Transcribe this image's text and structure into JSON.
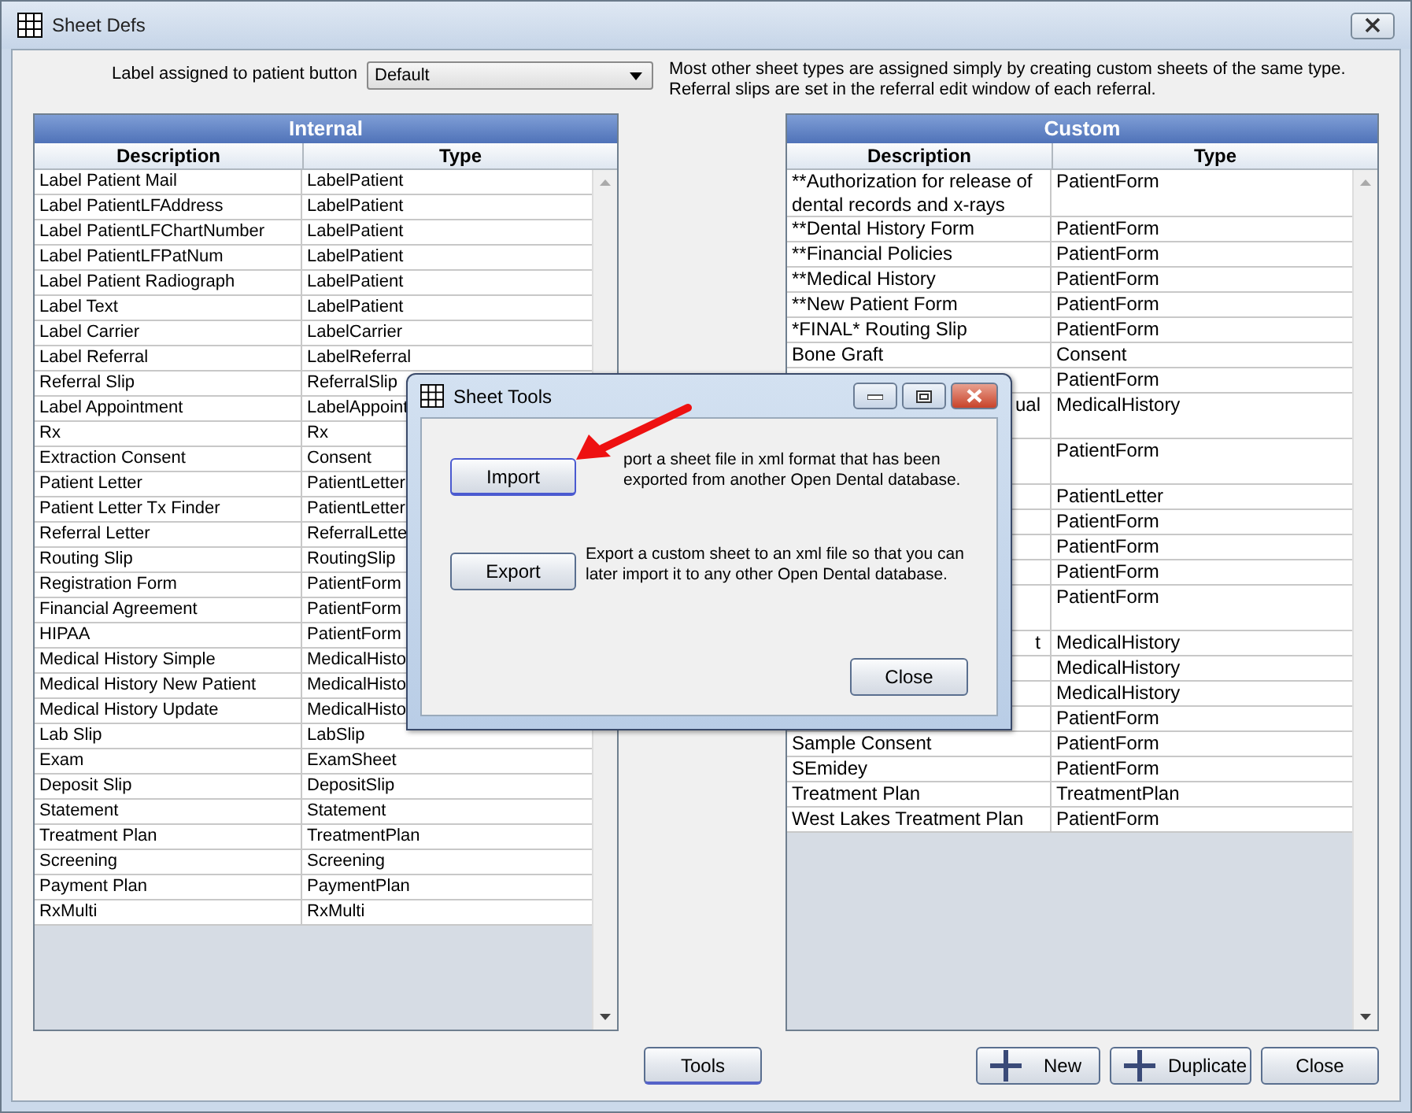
{
  "window": {
    "title": "Sheet Defs"
  },
  "patient_button": {
    "label": "Label assigned to patient button",
    "value": "Default"
  },
  "note_lines": [
    "Most other sheet types are assigned simply by creating custom sheets of the same type.",
    "Referral slips are set in the referral edit window of each referral."
  ],
  "internal": {
    "title": "Internal",
    "columns": [
      "Description",
      "Type"
    ],
    "rows": [
      {
        "description": "Label Patient Mail",
        "type": "LabelPatient"
      },
      {
        "description": "Label PatientLFAddress",
        "type": "LabelPatient"
      },
      {
        "description": "Label PatientLFChartNumber",
        "type": "LabelPatient"
      },
      {
        "description": "Label PatientLFPatNum",
        "type": "LabelPatient"
      },
      {
        "description": "Label Patient Radiograph",
        "type": "LabelPatient"
      },
      {
        "description": "Label Text",
        "type": "LabelPatient"
      },
      {
        "description": "Label Carrier",
        "type": "LabelCarrier"
      },
      {
        "description": "Label Referral",
        "type": "LabelReferral"
      },
      {
        "description": "Referral Slip",
        "type": "ReferralSlip"
      },
      {
        "description": "Label Appointment",
        "type": "LabelAppoint"
      },
      {
        "description": "Rx",
        "type": "Rx"
      },
      {
        "description": "Extraction Consent",
        "type": "Consent"
      },
      {
        "description": "Patient Letter",
        "type": "PatientLetter"
      },
      {
        "description": "Patient Letter Tx Finder",
        "type": "PatientLetter"
      },
      {
        "description": "Referral Letter",
        "type": "ReferralLette"
      },
      {
        "description": "Routing Slip",
        "type": "RoutingSlip"
      },
      {
        "description": "Registration Form",
        "type": "PatientForm"
      },
      {
        "description": "Financial Agreement",
        "type": "PatientForm"
      },
      {
        "description": "HIPAA",
        "type": "PatientForm"
      },
      {
        "description": "Medical History Simple",
        "type": "MedicalHisto"
      },
      {
        "description": "Medical History New Patient",
        "type": "MedicalHisto"
      },
      {
        "description": "Medical History Update",
        "type": "MedicalHisto"
      },
      {
        "description": "Lab Slip",
        "type": "LabSlip"
      },
      {
        "description": "Exam",
        "type": "ExamSheet"
      },
      {
        "description": "Deposit Slip",
        "type": "DepositSlip"
      },
      {
        "description": "Statement",
        "type": "Statement"
      },
      {
        "description": "Treatment Plan",
        "type": "TreatmentPlan"
      },
      {
        "description": "Screening",
        "type": "Screening"
      },
      {
        "description": "Payment Plan",
        "type": "PaymentPlan"
      },
      {
        "description": "RxMulti",
        "type": "RxMulti"
      }
    ]
  },
  "custom": {
    "title": "Custom",
    "columns": [
      "Description",
      "Type"
    ],
    "rows": [
      {
        "kind": "normal",
        "description": "**Authorization for release of dental records and x-rays",
        "type": "PatientForm"
      },
      {
        "kind": "normal",
        "description": "**Dental History Form",
        "type": "PatientForm"
      },
      {
        "kind": "normal",
        "description": "**Financial Policies",
        "type": "PatientForm"
      },
      {
        "kind": "normal",
        "description": "**Medical History",
        "type": "PatientForm"
      },
      {
        "kind": "normal",
        "description": "**New Patient Form",
        "type": "PatientForm"
      },
      {
        "kind": "normal",
        "description": "*FINAL* Routing Slip",
        "type": "PatientForm"
      },
      {
        "kind": "normal",
        "description": "Bone Graft",
        "type": "Consent"
      },
      {
        "kind": "normal",
        "type": "PatientForm"
      },
      {
        "kind": "two-line",
        "description": "ual",
        "cut": true,
        "type": "MedicalHistory"
      },
      {
        "kind": "two-line",
        "type": "PatientForm"
      },
      {
        "kind": "normal",
        "type": "PatientLetter"
      },
      {
        "kind": "normal",
        "type": "PatientForm"
      },
      {
        "kind": "normal",
        "type": "PatientForm"
      },
      {
        "kind": "normal",
        "type": "PatientForm"
      },
      {
        "kind": "two-line",
        "type": "PatientForm"
      },
      {
        "kind": "normal",
        "description": "t",
        "cut": true,
        "type": "MedicalHistory"
      },
      {
        "kind": "normal",
        "type": "MedicalHistory"
      },
      {
        "kind": "normal",
        "type": "MedicalHistory"
      },
      {
        "kind": "normal",
        "type": "PatientForm"
      },
      {
        "kind": "normal",
        "description": "Sample Consent",
        "type": "PatientForm"
      },
      {
        "kind": "normal",
        "description": "SEmidey",
        "type": "PatientForm"
      },
      {
        "kind": "normal",
        "description": "Treatment Plan",
        "type": "TreatmentPlan"
      },
      {
        "kind": "normal",
        "description": "West Lakes Treatment Plan",
        "type": "PatientForm"
      }
    ]
  },
  "tools_button": "Tools",
  "buttons": [
    {
      "kind": "add",
      "label": "New"
    },
    {
      "kind": "add",
      "label": "Duplicate"
    },
    {
      "kind": "plain",
      "label": "Close"
    }
  ],
  "dialog": {
    "title": "Sheet Tools",
    "actions": [
      {
        "label": "Import",
        "selected": true,
        "description": "port a sheet file in xml format that has been exported from another Open Dental database."
      },
      {
        "label": "Export",
        "selected": false,
        "description": "Export a custom sheet to an xml file so that you can later import it to any other Open Dental database."
      }
    ],
    "close": "Close"
  }
}
